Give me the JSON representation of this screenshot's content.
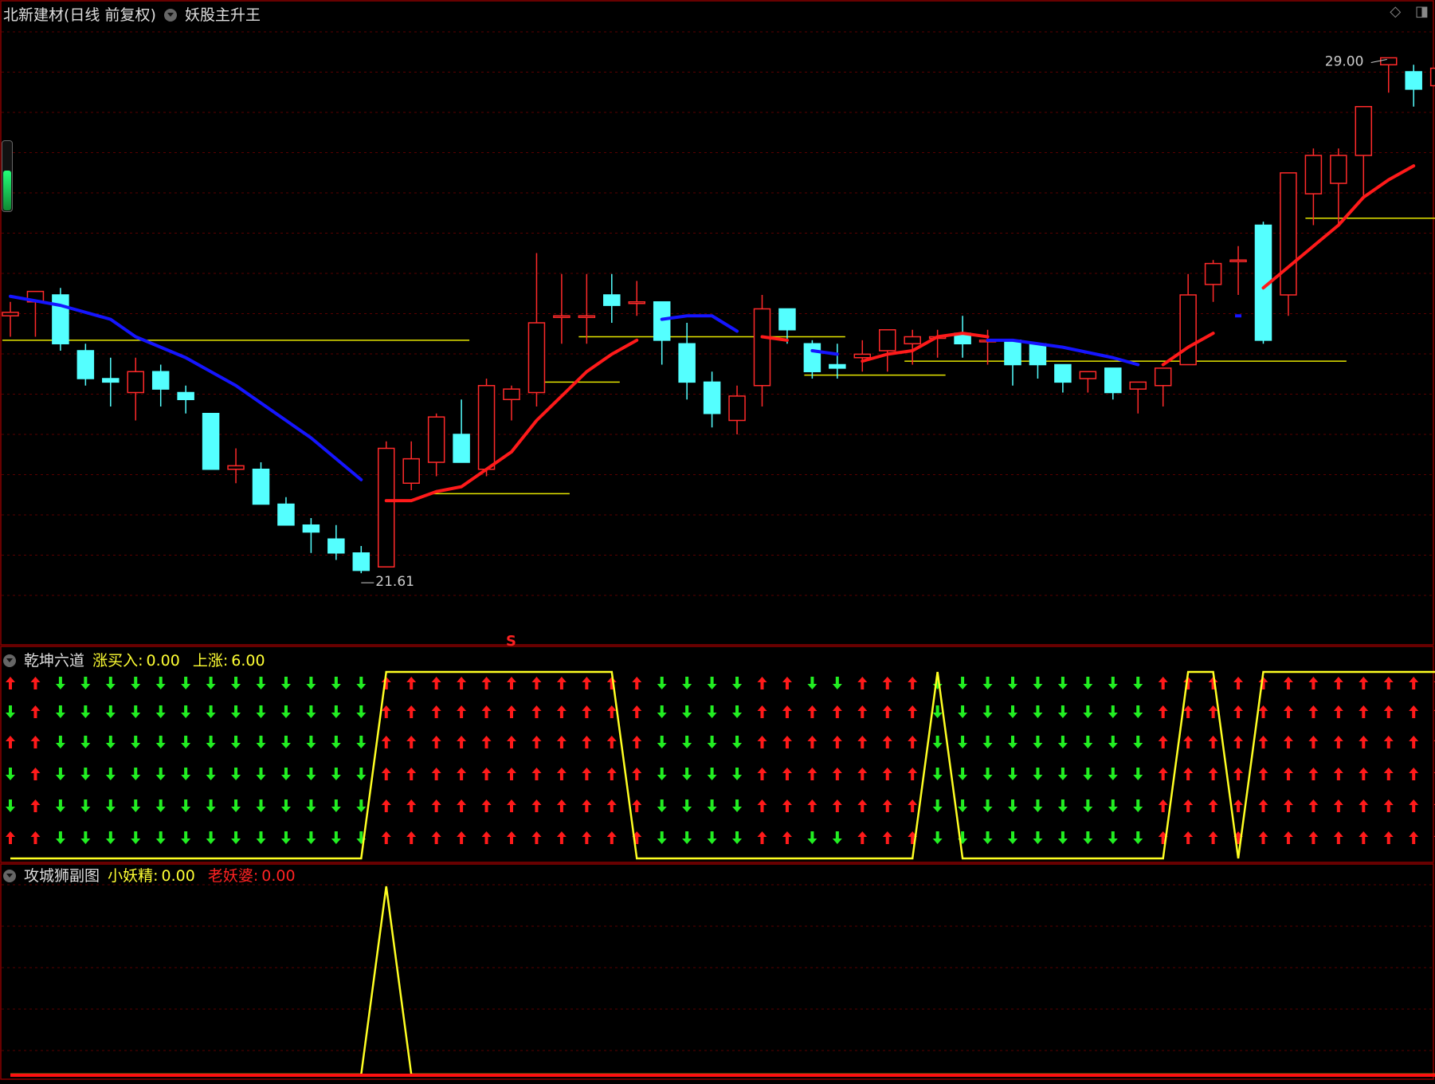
{
  "main_panel": {
    "stock_title": "北新建材(日线 前复权)",
    "indicator_name": "妖股主升王",
    "high_label": "29.00",
    "low_label": "21.61",
    "s_marker": "S"
  },
  "sub_panel_1": {
    "name": "乾坤六道",
    "label1": "涨买入:",
    "value1": "0.00",
    "label2": "上涨:",
    "value2": "6.00"
  },
  "sub_panel_2": {
    "name": "攻城狮副图",
    "label1": "小妖精:",
    "value1": "0.00",
    "label2": "老妖婆:",
    "value2": "0.00"
  },
  "colors": {
    "up": "#ff2a2a",
    "down": "#54ffff",
    "ma_up": "#ff1a1a",
    "ma_down": "#1515ff",
    "level": "#e6e600",
    "arrow_up": "#ff1a1a",
    "arrow_down": "#22ee22",
    "grid": "#5a0000",
    "title_yellow": "#ffff33",
    "title_red": "#ff2222"
  },
  "chart_data": [
    {
      "type": "candlestick",
      "title": "北新建材(日线 前复权)",
      "ylim": [
        20.8,
        29.6
      ],
      "ohlc": [
        [
          25.3,
          25.5,
          25.0,
          25.35
        ],
        [
          25.5,
          25.6,
          25.0,
          25.65
        ],
        [
          25.6,
          25.7,
          24.8,
          24.9
        ],
        [
          24.8,
          24.9,
          24.3,
          24.4
        ],
        [
          24.4,
          24.7,
          24.0,
          24.35
        ],
        [
          24.2,
          24.7,
          23.8,
          24.5
        ],
        [
          24.5,
          24.6,
          24.0,
          24.25
        ],
        [
          24.2,
          24.3,
          23.9,
          24.1
        ],
        [
          23.9,
          23.9,
          23.1,
          23.1
        ],
        [
          23.1,
          23.4,
          22.9,
          23.15
        ],
        [
          23.1,
          23.2,
          22.6,
          22.6
        ],
        [
          22.6,
          22.7,
          22.3,
          22.3
        ],
        [
          22.3,
          22.4,
          21.9,
          22.2
        ],
        [
          22.1,
          22.3,
          21.8,
          21.9
        ],
        [
          21.9,
          22.0,
          21.61,
          21.65
        ],
        [
          21.7,
          23.5,
          21.7,
          23.4
        ],
        [
          22.9,
          23.5,
          22.8,
          23.25
        ],
        [
          23.2,
          23.9,
          23.0,
          23.85
        ],
        [
          23.6,
          24.1,
          23.5,
          23.2
        ],
        [
          23.1,
          24.4,
          23.0,
          24.3
        ],
        [
          24.1,
          24.3,
          23.8,
          24.25
        ],
        [
          24.2,
          26.2,
          24.0,
          25.2
        ],
        [
          25.3,
          25.9,
          24.9,
          25.3
        ],
        [
          25.3,
          25.9,
          24.9,
          25.3
        ],
        [
          25.6,
          25.9,
          25.2,
          25.45
        ],
        [
          25.5,
          25.8,
          25.3,
          25.5
        ],
        [
          25.5,
          25.5,
          24.6,
          24.95
        ],
        [
          24.9,
          25.2,
          24.1,
          24.35
        ],
        [
          24.35,
          24.5,
          23.7,
          23.9
        ],
        [
          23.8,
          24.3,
          23.6,
          24.15
        ],
        [
          24.3,
          25.6,
          24.0,
          25.4
        ],
        [
          25.4,
          25.4,
          24.9,
          25.1
        ],
        [
          24.9,
          24.95,
          24.4,
          24.5
        ],
        [
          24.6,
          24.9,
          24.4,
          24.55
        ],
        [
          24.7,
          24.95,
          24.5,
          24.75
        ],
        [
          24.8,
          25.1,
          24.5,
          25.1
        ],
        [
          24.9,
          25.1,
          24.6,
          25.0
        ],
        [
          25.0,
          25.1,
          24.7,
          25.0
        ],
        [
          25.05,
          25.3,
          24.7,
          24.9
        ],
        [
          24.95,
          25.1,
          24.6,
          24.95
        ],
        [
          24.95,
          24.95,
          24.3,
          24.6
        ],
        [
          24.9,
          24.9,
          24.4,
          24.6
        ],
        [
          24.6,
          24.6,
          24.2,
          24.35
        ],
        [
          24.4,
          24.5,
          24.2,
          24.5
        ],
        [
          24.55,
          24.55,
          24.1,
          24.2
        ],
        [
          24.25,
          24.3,
          23.9,
          24.35
        ],
        [
          24.3,
          24.5,
          24.0,
          24.55
        ],
        [
          24.6,
          25.9,
          24.6,
          25.6
        ],
        [
          25.75,
          26.1,
          25.5,
          26.05
        ],
        [
          26.1,
          26.3,
          25.6,
          26.1
        ],
        [
          26.6,
          26.65,
          24.9,
          24.95
        ],
        [
          25.6,
          27.2,
          25.3,
          27.35
        ],
        [
          27.05,
          27.7,
          26.6,
          27.6
        ],
        [
          27.2,
          27.7,
          26.6,
          27.6
        ],
        [
          27.6,
          28.1,
          27.0,
          28.3
        ],
        [
          28.9,
          29.0,
          28.5,
          29.0
        ],
        [
          28.8,
          28.9,
          28.3,
          28.55
        ],
        [
          28.6,
          28.9,
          28.4,
          28.85
        ]
      ],
      "ma_series": {
        "name": "妖股主升王",
        "segments": [
          {
            "color": "down",
            "values": [
              [
                0,
                25.58
              ],
              [
                2,
                25.45
              ],
              [
                4,
                25.25
              ],
              [
                5,
                25.0
              ],
              [
                7,
                24.7
              ],
              [
                9,
                24.3
              ],
              [
                11,
                23.8
              ],
              [
                12,
                23.55
              ],
              [
                13,
                23.25
              ],
              [
                14,
                22.95
              ]
            ]
          },
          {
            "color": "up",
            "values": [
              [
                15,
                22.65
              ],
              [
                16,
                22.65
              ],
              [
                17,
                22.78
              ],
              [
                18,
                22.85
              ],
              [
                19,
                23.1
              ],
              [
                20,
                23.35
              ],
              [
                21,
                23.8
              ],
              [
                22,
                24.15
              ],
              [
                23,
                24.5
              ],
              [
                24,
                24.75
              ],
              [
                25,
                24.95
              ]
            ]
          },
          {
            "color": "down",
            "values": [
              [
                26,
                25.25
              ],
              [
                27,
                25.3
              ],
              [
                28,
                25.3
              ],
              [
                29,
                25.08
              ]
            ]
          },
          {
            "color": "up",
            "values": [
              [
                30,
                25.0
              ],
              [
                31,
                24.95
              ]
            ]
          },
          {
            "color": "down",
            "values": [
              [
                32,
                24.8
              ],
              [
                33,
                24.75
              ]
            ]
          },
          {
            "color": "up",
            "values": [
              [
                34,
                24.65
              ],
              [
                35,
                24.75
              ],
              [
                36,
                24.8
              ],
              [
                37,
                25.0
              ],
              [
                38,
                25.05
              ],
              [
                39,
                25.0
              ]
            ]
          },
          {
            "color": "down",
            "values": [
              [
                39,
                24.95
              ],
              [
                40,
                24.95
              ],
              [
                42,
                24.85
              ],
              [
                44,
                24.7
              ],
              [
                45,
                24.6
              ]
            ]
          },
          {
            "color": "up",
            "values": [
              [
                46,
                24.6
              ],
              [
                47,
                24.85
              ],
              [
                48,
                25.05
              ]
            ]
          },
          {
            "color": "down",
            "values": [
              [
                49,
                25.3
              ]
            ]
          },
          {
            "color": "up",
            "values": [
              [
                50,
                25.7
              ],
              [
                51,
                26.0
              ],
              [
                52,
                26.3
              ],
              [
                53,
                26.6
              ],
              [
                54,
                27.0
              ],
              [
                55,
                27.25
              ],
              [
                56,
                27.45
              ]
            ]
          }
        ]
      },
      "levels": [
        {
          "start": 0,
          "end": 18,
          "value": 24.95
        },
        {
          "start": 17,
          "end": 22,
          "value": 22.75
        },
        {
          "start": 21,
          "end": 24,
          "value": 24.35
        },
        {
          "start": 23,
          "end": 33,
          "value": 25.0
        },
        {
          "start": 32,
          "end": 37,
          "value": 24.45
        },
        {
          "start": 36,
          "end": 53,
          "value": 24.65
        },
        {
          "start": 52,
          "end": 57,
          "value": 26.7
        }
      ],
      "annotations": [
        {
          "text": "29.00",
          "x": 55,
          "value": 29.0
        },
        {
          "text": "21.61",
          "x": 14,
          "value": 21.61
        }
      ]
    },
    {
      "type": "arrow-grid",
      "title": "乾坤六道",
      "rows": 6,
      "directions": [
        "UDUDDU",
        "UUUUUU",
        "DDDDDD",
        "DDDDDD",
        "DDDDDD",
        "DDDDDD",
        "DDDDDD",
        "DDDDDD",
        "DDDDDD",
        "DDDDDD",
        "DDDDDD",
        "DDDDDD",
        "DDDDDD",
        "DDDDDD",
        "DDDDDD",
        "UUUUUU",
        "UUUUUU",
        "UUUUUU",
        "UUUUUU",
        "UUUUUU",
        "UUUUUU",
        "UUUUUU",
        "UUUUUU",
        "UUUUUU",
        "UUUUUU",
        "UUUUUU",
        "DDDDDD",
        "DDDDDD",
        "DDDDDD",
        "DDDDDD",
        "UUUUUU",
        "UUUUUU",
        "DUUUUD",
        "DUUUUD",
        "UUUUUU",
        "UUUUUU",
        "UUUUUU",
        "DDDDDD",
        "DDDDDD",
        "DDDDDD",
        "DDDDDD",
        "DDDDDD",
        "DDDDDD",
        "DDDDDD",
        "DDDDDD",
        "DDDDDD",
        "UUUUUU",
        "UUUUUU",
        "UUUUUU",
        "UUUUUU",
        "UUUUUU",
        "UUUUUU",
        "UUUUUU",
        "UUUUUU",
        "UUUUUU",
        "UUUUUU",
        "UUUUUU",
        "UUUUUU"
      ],
      "first_col_rows": "DUUDUU",
      "second_col_rows": "UUUUUU",
      "signal_line": {
        "name": "上涨",
        "ylim": [
          0,
          6
        ],
        "values": [
          0,
          0,
          0,
          0,
          0,
          0,
          0,
          0,
          0,
          0,
          0,
          0,
          0,
          0,
          0,
          6,
          6,
          6,
          6,
          6,
          6,
          6,
          6,
          6,
          6,
          0,
          0,
          0,
          0,
          0,
          0,
          0,
          0,
          0,
          0,
          0,
          0,
          6,
          0,
          0,
          0,
          0,
          0,
          0,
          0,
          0,
          0,
          6,
          6,
          0,
          6,
          6,
          6,
          6,
          6,
          6,
          6,
          6
        ]
      }
    },
    {
      "type": "line",
      "title": "攻城狮副图",
      "ylim": [
        0,
        1
      ],
      "series": [
        {
          "name": "小妖精",
          "values": [
            0,
            0,
            0,
            0,
            0,
            0,
            0,
            0,
            0,
            0,
            0,
            0,
            0,
            0,
            0,
            1,
            0,
            0,
            0,
            0,
            0,
            0,
            0,
            0,
            0,
            0,
            0,
            0,
            0,
            0,
            0,
            0,
            0,
            0,
            0,
            0,
            0,
            0,
            0,
            0,
            0,
            0,
            0,
            0,
            0,
            0,
            0,
            0,
            0,
            0,
            0,
            0,
            0,
            0,
            0,
            0,
            0,
            0
          ]
        },
        {
          "name": "老妖婆",
          "values": [
            0,
            0,
            0,
            0,
            0,
            0,
            0,
            0,
            0,
            0,
            0,
            0,
            0,
            0,
            0,
            0,
            0,
            0,
            0,
            0,
            0,
            0,
            0,
            0,
            0,
            0,
            0,
            0,
            0,
            0,
            0,
            0,
            0,
            0,
            0,
            0,
            0,
            0,
            0,
            0,
            0,
            0,
            0,
            0,
            0,
            0,
            0,
            0,
            0,
            0,
            0,
            0,
            0,
            0,
            0,
            0,
            0,
            0
          ]
        }
      ]
    }
  ]
}
